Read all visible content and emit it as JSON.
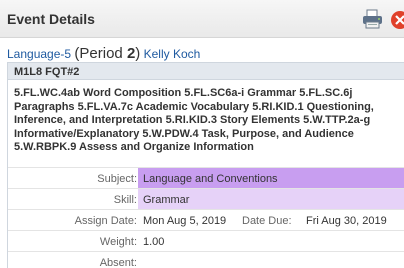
{
  "dialog": {
    "title": "Event Details"
  },
  "heading": {
    "course": "Language-5",
    "period_prefix": "(Period ",
    "period_number": "2",
    "period_suffix": ")",
    "teacher": "Kelly Koch"
  },
  "assignment": {
    "name": "M1L8 FQT#2",
    "standards": "5.FL.WC.4ab Word Composition 5.FL.SC6a-i Grammar 5.FL.SC.6j Paragraphs 5.FL.VA.7c Academic Vocabulary 5.RI.KID.1 Questioning, Inference, and Interpretation 5.RI.KID.3 Story Elements 5.W.TTP.2a-g Informative/Explanatory 5.W.PDW.4 Task, Purpose, and Audience 5.W.RBPK.9 Assess and Organize Information"
  },
  "details": {
    "subject_label": "Subject:",
    "subject_value": "Language and Conventions",
    "skill_label": "Skill:",
    "skill_value": "Grammar",
    "assign_date_label": "Assign Date:",
    "assign_date_value": "Mon Aug 5, 2019",
    "due_date_label": "Date Due:",
    "due_date_value": "Fri Aug 30, 2019",
    "weight_label": "Weight:",
    "weight_value": "1.00",
    "absent_label": "Absent:",
    "absent_value": ""
  },
  "icons": {
    "print": "printer-icon",
    "close": "close-icon"
  },
  "colors": {
    "subject_highlight": "#c89ef0",
    "skill_highlight": "#e6d2f8",
    "link": "#1f5aa0",
    "close_button": "#e0412b"
  }
}
